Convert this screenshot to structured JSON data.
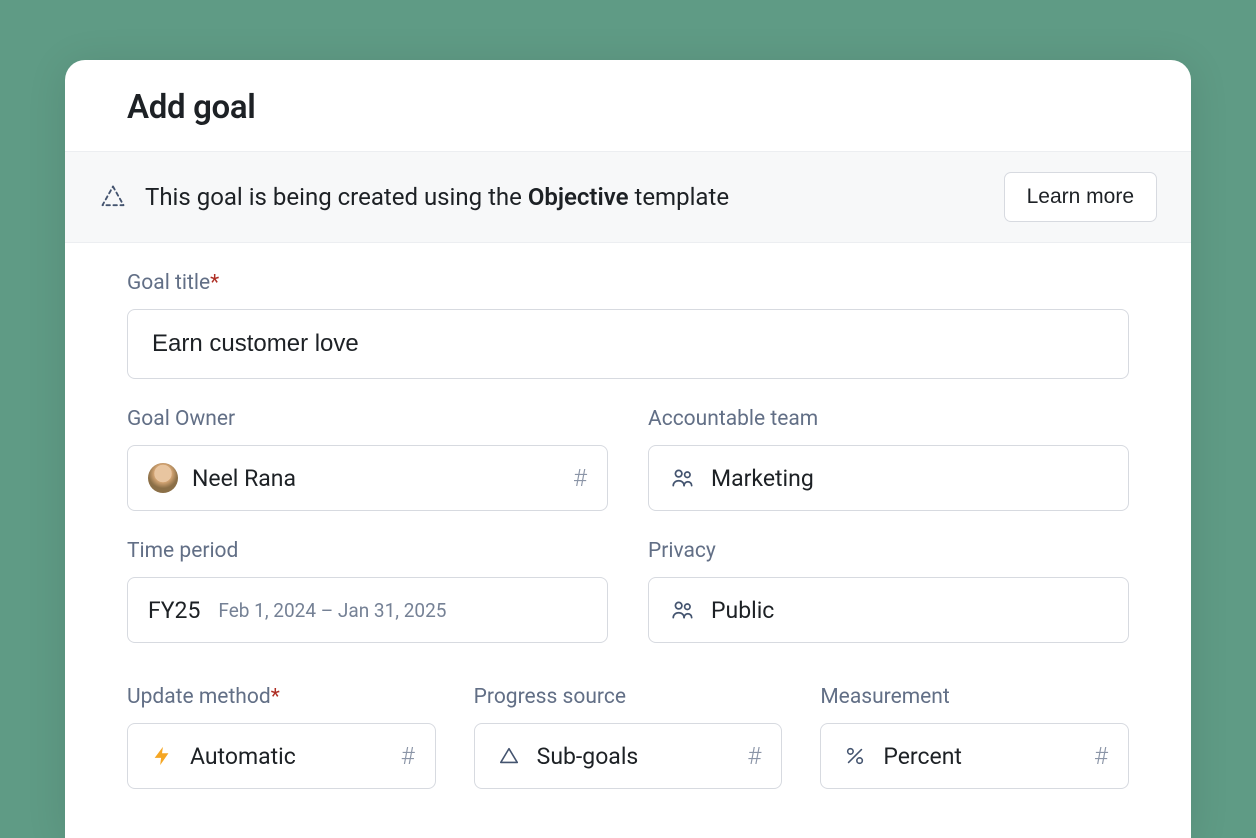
{
  "modal": {
    "title": "Add goal"
  },
  "banner": {
    "text_prefix": "This goal is being created using the ",
    "text_bold": "Objective",
    "text_suffix": " template",
    "learn_more": "Learn more"
  },
  "fields": {
    "title": {
      "label": "Goal title",
      "required": "*",
      "value": "Earn customer love"
    },
    "owner": {
      "label": "Goal Owner",
      "value": "Neel Rana"
    },
    "team": {
      "label": "Accountable team",
      "value": "Marketing"
    },
    "period": {
      "label": "Time period",
      "value": "FY25",
      "range": "Feb 1, 2024 – Jan 31, 2025"
    },
    "privacy": {
      "label": "Privacy",
      "value": "Public"
    },
    "update_method": {
      "label": "Update method",
      "required": "*",
      "value": "Automatic"
    },
    "progress_source": {
      "label": "Progress source",
      "value": "Sub-goals"
    },
    "measurement": {
      "label": "Measurement",
      "value": "Percent"
    }
  }
}
